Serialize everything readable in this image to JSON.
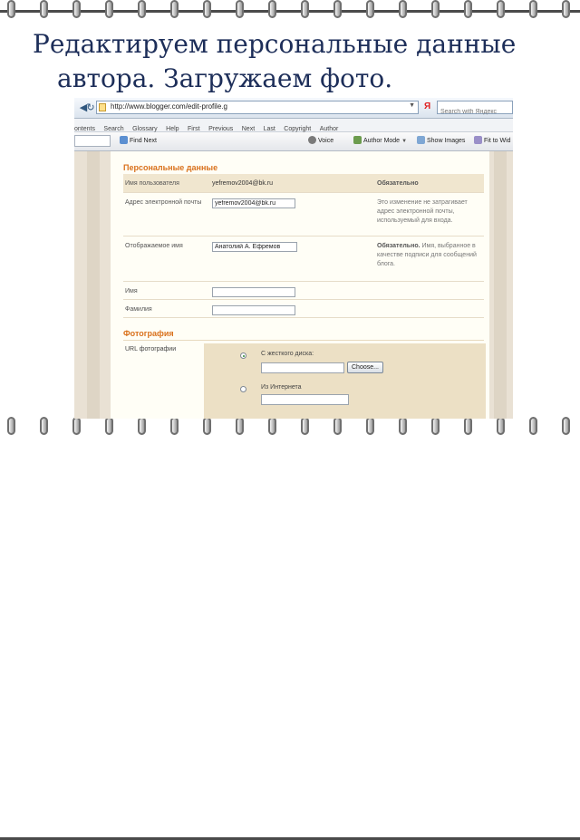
{
  "slide": {
    "title_line1": "Редактируем персональные данные",
    "title_line2": "автора. Загружаем фото."
  },
  "browser": {
    "url": "http://www.blogger.com/edit-profile.g",
    "search_engine_logo": "Я",
    "search_placeholder": "Search with Яндекс",
    "menu": [
      "ontents",
      "Search",
      "Glossary",
      "Help",
      "First",
      "Previous",
      "Next",
      "Last",
      "Copyright",
      "Author"
    ],
    "toolbar": {
      "find_next": "Find Next",
      "voice": "Voice",
      "author_mode": "Author Mode",
      "show_images": "Show Images",
      "fit_to_width": "Fit to Wid"
    }
  },
  "profile": {
    "section_title": "Персональные данные",
    "rows": [
      {
        "label": "Имя пользователя",
        "value": "yefremov2004@bk.ru",
        "note_bold": "Обязательно",
        "note": ""
      },
      {
        "label": "Адрес электронной почты",
        "input_value": "yefremov2004@bk.ru",
        "note_bold": "",
        "note": "Это изменение не затрагивает адрес электронной почты, используемый для входа."
      },
      {
        "label": "Отображаемое имя",
        "input_value": "Анатолий А. Ефремов",
        "note_bold": "Обязательно.",
        "note": "Имя, выбранное в качестве подписи для сообщений блога."
      },
      {
        "label": "Имя",
        "input_value": ""
      },
      {
        "label": "Фамилия",
        "input_value": ""
      }
    ]
  },
  "photo": {
    "section_title": "Фотография",
    "url_label": "URL фотографии",
    "option_disk": "С жесткого диска:",
    "choose_button": "Choose...",
    "option_internet": "Из Интернета",
    "selected_option": "disk"
  }
}
